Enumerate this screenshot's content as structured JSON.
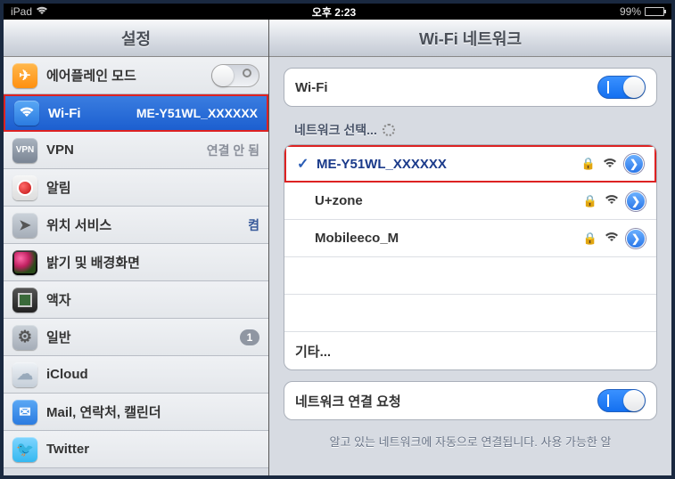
{
  "status": {
    "device": "iPad",
    "time": "오후 2:23",
    "battery_pct": "99%"
  },
  "sidebar": {
    "title": "설정",
    "items": [
      {
        "label": "에어플레인 모드",
        "value": ""
      },
      {
        "label": "Wi-Fi",
        "value": "ME-Y51WL_XXXXXX"
      },
      {
        "label": "VPN",
        "value": "연결 안 됨"
      },
      {
        "label": "알림",
        "value": ""
      },
      {
        "label": "위치 서비스",
        "value": "켬"
      },
      {
        "label": "밝기 및 배경화면",
        "value": ""
      },
      {
        "label": "액자",
        "value": ""
      },
      {
        "label": "일반",
        "value": "1"
      },
      {
        "label": "iCloud",
        "value": ""
      },
      {
        "label": "Mail, 연락처, 캘린더",
        "value": ""
      },
      {
        "label": "Twitter",
        "value": ""
      }
    ]
  },
  "detail": {
    "title": "Wi-Fi 네트워크",
    "wifi_label": "Wi-Fi",
    "choose_label": "네트워크 선택...",
    "networks": [
      {
        "name": "ME-Y51WL_XXXXXX",
        "locked": true,
        "connected": true
      },
      {
        "name": "U+zone",
        "locked": true,
        "connected": false
      },
      {
        "name": "Mobileeco_M",
        "locked": true,
        "connected": false
      }
    ],
    "other_label": "기타...",
    "ask_join_label": "네트워크 연결 요청",
    "footer": "알고 있는 네트워크에 자동으로 연결됩니다. 사용 가능한 알"
  }
}
